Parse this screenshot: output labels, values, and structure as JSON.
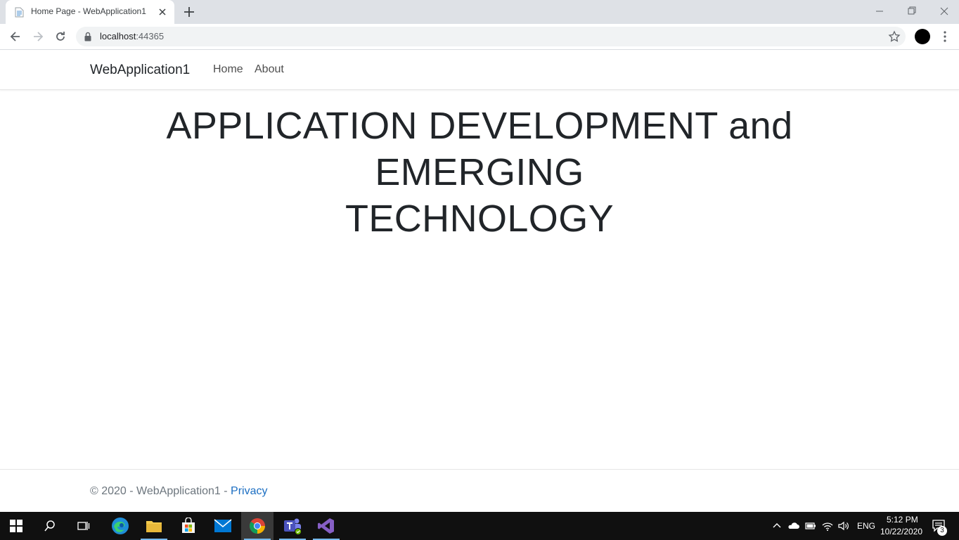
{
  "browser": {
    "tab_title": "Home Page - WebApplication1",
    "url_host": "localhost",
    "url_port": ":44365"
  },
  "site": {
    "brand": "WebApplication1",
    "nav": [
      {
        "label": "Home"
      },
      {
        "label": "About"
      }
    ],
    "hero_line1": "APPLICATION DEVELOPMENT and EMERGING",
    "hero_line2": "TECHNOLOGY",
    "footer_text": "© 2020 - WebApplication1 - ",
    "footer_link": "Privacy"
  },
  "taskbar": {
    "apps": [
      "start-icon",
      "search-icon",
      "task-view-icon",
      "edge-icon",
      "file-explorer-icon",
      "store-icon",
      "mail-icon",
      "chrome-icon",
      "teams-icon",
      "visual-studio-icon"
    ],
    "language": "ENG",
    "time": "5:12 PM",
    "date": "10/22/2020",
    "notification_count": "3"
  },
  "colors": {
    "accent": "#1b6ec2",
    "taskbar": "#101010",
    "tabstrip": "#dee1e6"
  }
}
